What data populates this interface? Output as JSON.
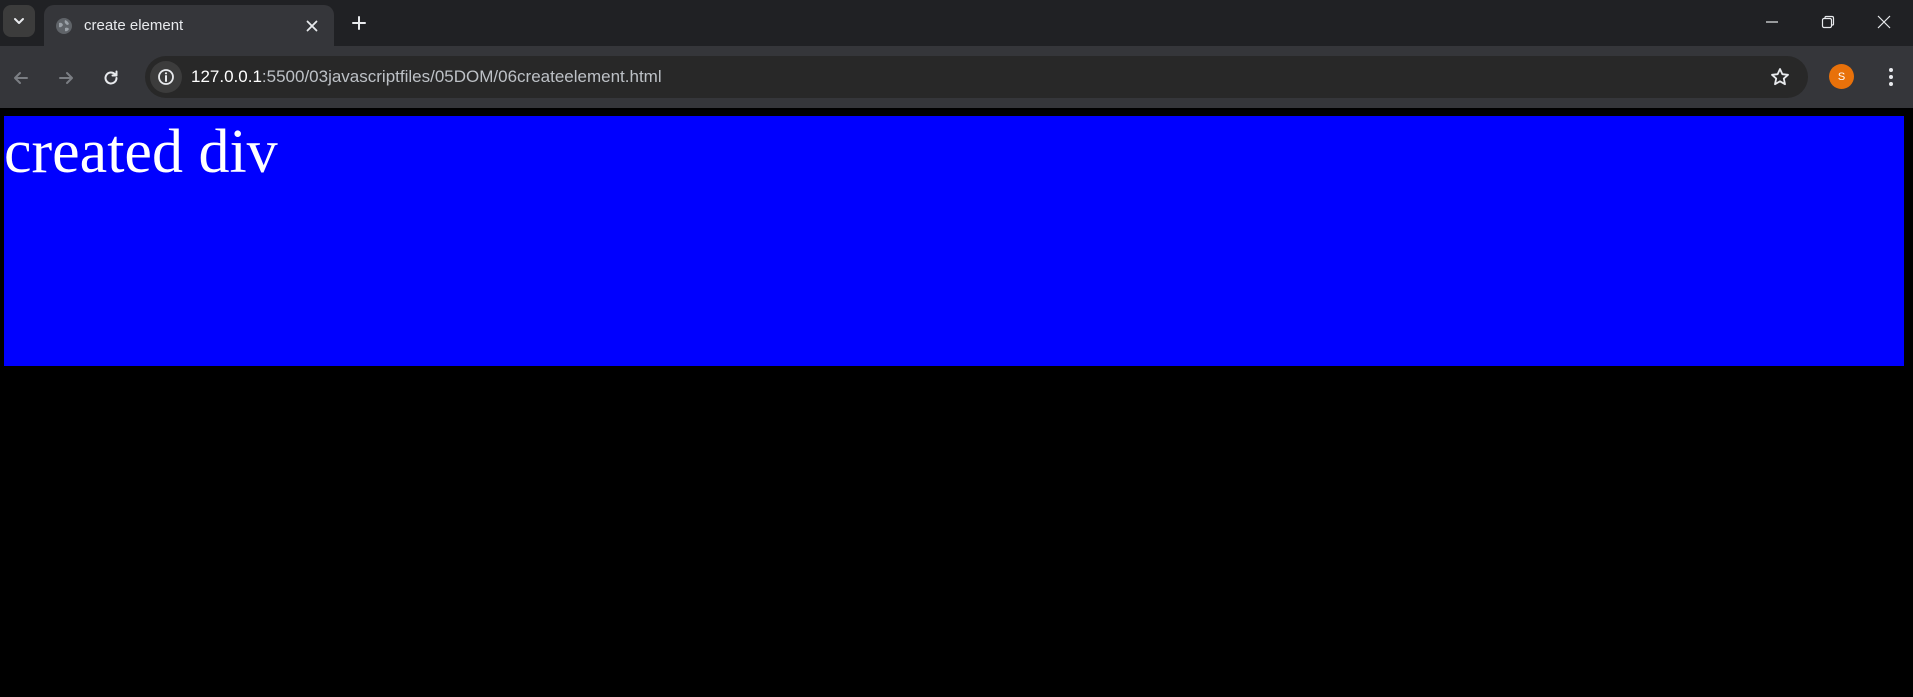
{
  "tab": {
    "title": "create element"
  },
  "address_bar": {
    "host": "127.0.0.1",
    "path": ":5500/03javascriptfiles/05DOM/06createelement.html"
  },
  "profile": {
    "initial": "S",
    "color": "#e8710a"
  },
  "icons": {
    "tab_search": "chevron-down-icon",
    "favicon": "globe-icon",
    "tab_close": "close-icon",
    "new_tab": "plus-icon",
    "minimize": "minimize-icon",
    "restore": "restore-icon",
    "close_window": "close-icon",
    "back": "arrow-left-icon",
    "forward": "arrow-right-icon",
    "reload": "reload-icon",
    "site_info": "info-icon",
    "bookmark": "star-icon",
    "menu": "kebab-menu-icon"
  },
  "page": {
    "background": "#000000",
    "div_text": "created div",
    "div_background": "#0000ff",
    "div_color": "#ffffff"
  }
}
